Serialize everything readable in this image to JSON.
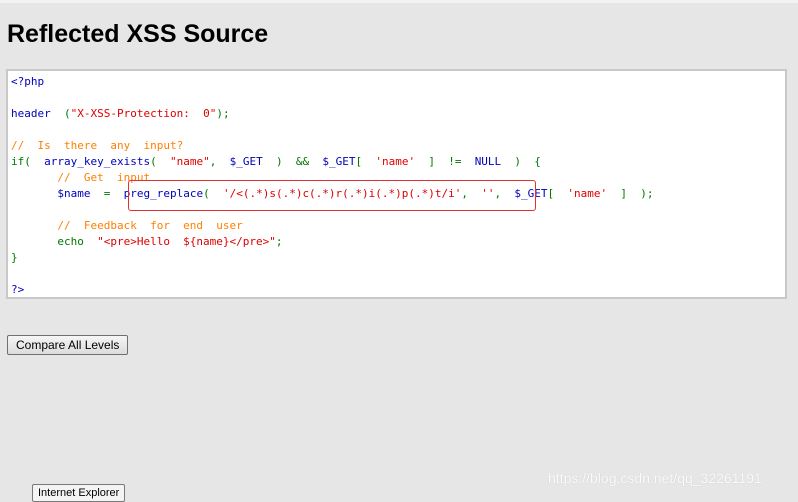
{
  "page": {
    "title": "Reflected XSS Source"
  },
  "code": {
    "lines": [
      [
        {
          "t": "<?php",
          "c": "c-df"
        }
      ],
      [],
      [
        {
          "t": "header",
          "c": "c-df"
        },
        {
          "t": "  (",
          "c": "c-kw"
        },
        {
          "t": "\"X-XSS-Protection:  0\"",
          "c": "c-str"
        },
        {
          "t": ");",
          "c": "c-kw"
        }
      ],
      [],
      [
        {
          "t": "//  Is  there  any  input?",
          "c": "c-cm"
        }
      ],
      [
        {
          "t": "if(  ",
          "c": "c-kw"
        },
        {
          "t": "array_key_exists",
          "c": "c-df"
        },
        {
          "t": "(  ",
          "c": "c-kw"
        },
        {
          "t": "\"name\"",
          "c": "c-str"
        },
        {
          "t": ",  ",
          "c": "c-kw"
        },
        {
          "t": "$_GET",
          "c": "c-df"
        },
        {
          "t": "  )  &&  ",
          "c": "c-kw"
        },
        {
          "t": "$_GET",
          "c": "c-df"
        },
        {
          "t": "[  ",
          "c": "c-kw"
        },
        {
          "t": "'name'",
          "c": "c-str"
        },
        {
          "t": "  ]  !=  ",
          "c": "c-kw"
        },
        {
          "t": "NULL",
          "c": "c-df"
        },
        {
          "t": "  )  {",
          "c": "c-kw"
        }
      ],
      [
        {
          "t": "       //  Get  input",
          "c": "c-cm"
        }
      ],
      [
        {
          "t": "       $name",
          "c": "c-df"
        },
        {
          "t": "  =  ",
          "c": "c-kw"
        },
        {
          "t": "preg_replace",
          "c": "c-df"
        },
        {
          "t": "(  ",
          "c": "c-kw"
        },
        {
          "t": "'/<(.*)s(.*)c(.*)r(.*)i(.*)p(.*)t/i'",
          "c": "c-str"
        },
        {
          "t": ",  ",
          "c": "c-kw"
        },
        {
          "t": "''",
          "c": "c-str"
        },
        {
          "t": ",  ",
          "c": "c-kw"
        },
        {
          "t": "$_GET",
          "c": "c-df"
        },
        {
          "t": "[  ",
          "c": "c-kw"
        },
        {
          "t": "'name'",
          "c": "c-str"
        },
        {
          "t": "  ]  );",
          "c": "c-kw"
        }
      ],
      [],
      [
        {
          "t": "       //  Feedback  for  end  user",
          "c": "c-cm"
        }
      ],
      [
        {
          "t": "       echo  ",
          "c": "c-kw"
        },
        {
          "t": "\"<pre>Hello  ${name}</pre>\"",
          "c": "c-str"
        },
        {
          "t": ";",
          "c": "c-kw"
        }
      ],
      [
        {
          "t": "}",
          "c": "c-kw"
        }
      ],
      [],
      [
        {
          "t": "?>",
          "c": "c-df"
        }
      ]
    ]
  },
  "buttons": {
    "compare_label": "Compare All Levels"
  },
  "watermark": {
    "text": "https://blog.csdn.net/qq_32261191"
  },
  "taskbar": {
    "item_label": "Internet Explorer"
  },
  "colors": {
    "default": "#0000bb",
    "keyword": "#007700",
    "string": "#dd0000",
    "comment": "#ff8000",
    "highlight_border": "#e03030"
  }
}
